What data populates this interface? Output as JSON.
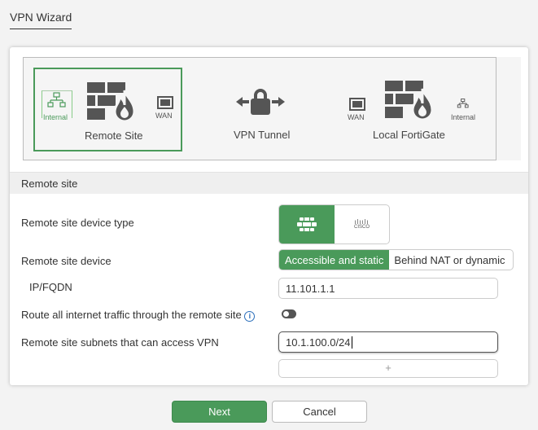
{
  "title": "VPN Wizard",
  "diagram": {
    "remote_site": "Remote Site",
    "vpn_tunnel": "VPN Tunnel",
    "local": "Local FortiGate",
    "internal": "Internal",
    "wan": "WAN"
  },
  "section": "Remote site",
  "form": {
    "device_type_label": "Remote site device type",
    "device_type_options": [
      "FortiGate",
      "Cisco"
    ],
    "cisco_text": "CISCO",
    "device_label": "Remote site device",
    "device_options": [
      "Accessible and static",
      "Behind NAT or dynamic"
    ],
    "ip_label": "IP/FQDN",
    "ip_value": "11.101.1.1",
    "route_label": "Route all internet traffic through the remote site",
    "route_enabled": false,
    "subnets_label": "Remote site subnets that can access VPN",
    "subnet_value": "10.1.100.0/24",
    "add_symbol": "+"
  },
  "buttons": {
    "next": "Next",
    "cancel": "Cancel"
  },
  "colors": {
    "accent": "#4a9a5a"
  }
}
